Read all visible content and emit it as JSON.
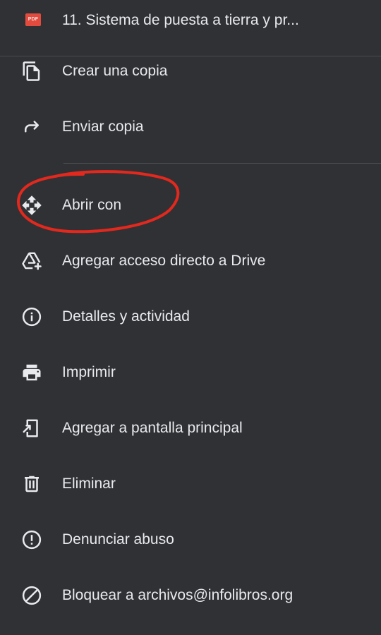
{
  "header": {
    "pdf_badge": "PDF",
    "file_name": "11. Sistema de puesta a tierra y pr..."
  },
  "menu": [
    {
      "label": "Crear una copia",
      "icon": "copy-icon"
    },
    {
      "label": "Enviar copia",
      "icon": "share-arrow-icon"
    },
    {
      "label": "Abrir con",
      "icon": "open-with-icon"
    },
    {
      "label": "Agregar acceso directo a Drive",
      "icon": "add-shortcut-drive-icon"
    },
    {
      "label": "Detalles y actividad",
      "icon": "info-icon"
    },
    {
      "label": "Imprimir",
      "icon": "print-icon"
    },
    {
      "label": "Agregar a pantalla principal",
      "icon": "add-to-home-screen-icon"
    },
    {
      "label": "Eliminar",
      "icon": "trash-icon"
    },
    {
      "label": "Denunciar abuso",
      "icon": "report-icon"
    },
    {
      "label": "Bloquear a archivos@infolibros.org",
      "icon": "block-icon"
    }
  ],
  "colors": {
    "background": "#303134",
    "text": "#e8eaed",
    "icon": "#e8eaed",
    "divider": "#4a4c50",
    "pdf_badge": "#e44b3f",
    "annotation": "#e3281e"
  },
  "annotation": {
    "type": "hand-drawn-ellipse",
    "target": "Abrir con"
  }
}
